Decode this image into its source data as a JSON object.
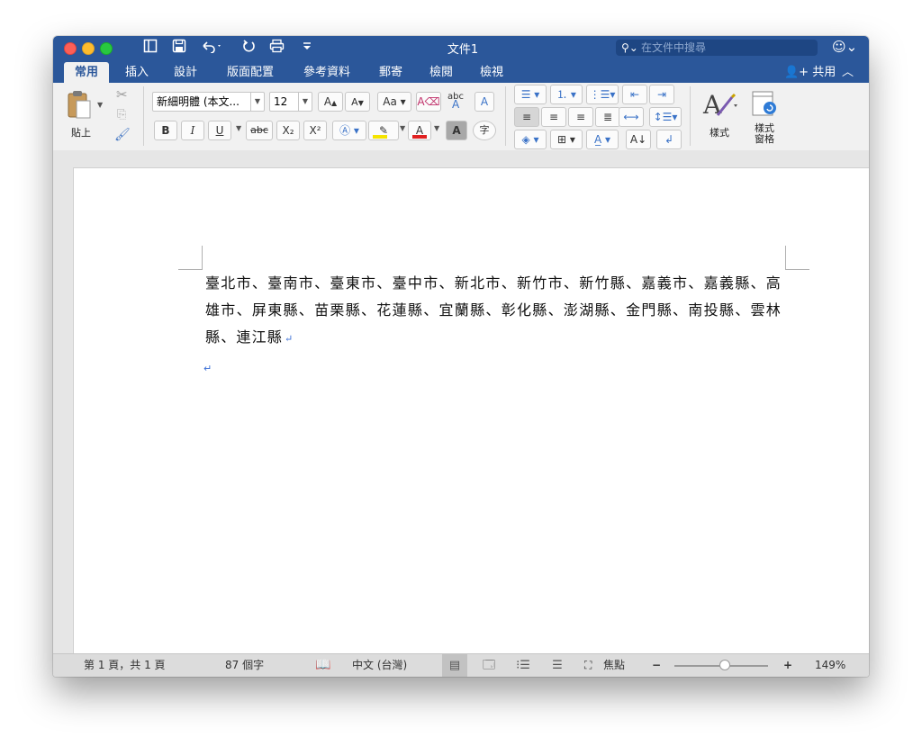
{
  "window": {
    "title": "文件1",
    "search_placeholder": "在文件中搜尋",
    "share_label": "共用"
  },
  "tabs": [
    {
      "label": "常用",
      "active": true
    },
    {
      "label": "插入"
    },
    {
      "label": "設計"
    },
    {
      "label": "版面配置"
    },
    {
      "label": "參考資料"
    },
    {
      "label": "郵寄"
    },
    {
      "label": "檢閱"
    },
    {
      "label": "檢視"
    }
  ],
  "ribbon": {
    "paste_label": "貼上",
    "font_name": "新細明體 (本文...",
    "font_size": "12",
    "bold": "B",
    "italic": "I",
    "underline": "U",
    "strikethrough": "abc",
    "subscript": "X₂",
    "superscript": "X²",
    "phonetic_guide": "字",
    "styles_label": "樣式",
    "styles_pane_label_1": "樣式",
    "styles_pane_label_2": "窗格"
  },
  "document": {
    "paragraph": "臺北市、臺南市、臺東市、臺中市、新北市、新竹市、新竹縣、嘉義市、嘉義縣、高雄市、屏東縣、苗栗縣、花蓮縣、宜蘭縣、彰化縣、澎湖縣、金門縣、南投縣、雲林縣、連江縣"
  },
  "status": {
    "page_info": "第 1 頁，共 1 頁",
    "word_count": "87 個字",
    "language": "中文 (台灣)",
    "focus_label": "焦點",
    "zoom": "149%",
    "zoom_level": 0.54
  },
  "colors": {
    "title_bar": "#2b579a",
    "font_color_underline": "#e02020",
    "highlight_color": "#f5e400"
  }
}
